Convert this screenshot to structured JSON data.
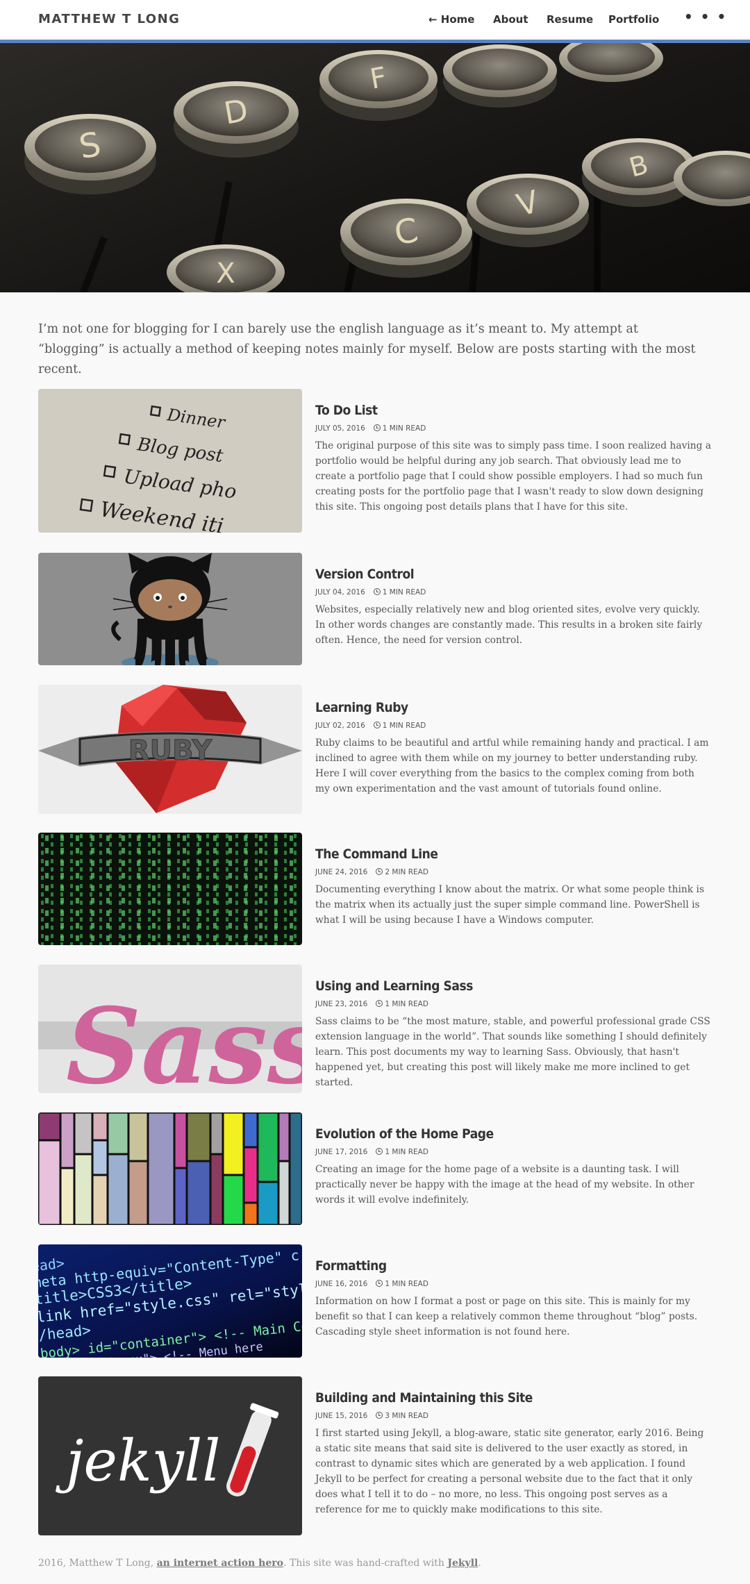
{
  "header": {
    "site_title": "MATTHEW T LONG",
    "nav": {
      "home": "← Home",
      "about": "About",
      "resume": "Resume",
      "portfolio": "Portfolio",
      "more": "• • •"
    },
    "accent_color": "#5a84c4"
  },
  "intro": "I’m not one for blogging for I can barely use the english language as it’s meant to. My attempt at “blogging” is actually a method of keeping notes mainly for myself. Below are posts starting with the most recent.",
  "posts": [
    {
      "title": "To Do List",
      "date": "JULY 05, 2016",
      "read_time": "1 MIN READ",
      "excerpt": "The original purpose of this site was to simply pass time. I soon realized having a portfolio would be helpful during any job search. That obviously lead me to create a portfolio page that I could show possible employers. I had so much fun creating posts for the portfolio page that I wasn't ready to slow down designing this site. This ongoing post details plans that I have for this site."
    },
    {
      "title": "Version Control",
      "date": "JULY 04, 2016",
      "read_time": "1 MIN READ",
      "excerpt": "Websites, especially relatively new and blog oriented sites, evolve very quickly. In other words changes are constantly made. This results in a broken site fairly often. Hence, the need for version control."
    },
    {
      "title": "Learning Ruby",
      "date": "JULY 02, 2016",
      "read_time": "1 MIN READ",
      "excerpt": "Ruby claims to be beautiful and artful while remaining handy and practical. I am inclined to agree with them while on my journey to better understanding ruby. Here I will cover everything from the basics to the complex coming from both my own experimentation and the vast amount of tutorials found online."
    },
    {
      "title": "The Command Line",
      "date": "JUNE 24, 2016",
      "read_time": "2 MIN READ",
      "excerpt": "Documenting everything I know about the matrix. Or what some people think is the matrix when its actually just the super simple command line. PowerShell is what I will be using because I have a Windows computer."
    },
    {
      "title": "Using and Learning Sass",
      "date": "JUNE 23, 2016",
      "read_time": "1 MIN READ",
      "excerpt": "Sass claims to be “the most mature, stable, and powerful professional grade CSS extension language in the world”. That sounds like something I should definitely learn. This post documents my way to learning Sass. Obviously, that hasn't happened yet, but creating this post will likely make me more inclined to get started."
    },
    {
      "title": "Evolution of the Home Page",
      "date": "JUNE 17, 2016",
      "read_time": "1 MIN READ",
      "excerpt": "Creating an image for the home page of a website is a daunting task. I will practically never be happy with the image at the head of my website. In other words it will evolve indefinitely."
    },
    {
      "title": "Formatting",
      "date": "JUNE 16, 2016",
      "read_time": "1 MIN READ",
      "excerpt": "Information on how I format a post or page on this site. This is mainly for my benefit so that I can keep a relatively common theme throughout “blog” posts. Cascading style sheet information is not found here."
    },
    {
      "title": "Building and Maintaining this Site",
      "date": "JUNE 15, 2016",
      "read_time": "3 MIN READ",
      "excerpt": "I first started using Jekyll, a blog-aware, static site generator, early 2016. Being a static site means that said site is delivered to the user exactly as stored, in contrast to dynamic sites which are generated by a web application. I found Jekyll to be perfect for creating a personal website due to the fact that it only does what I tell it to do – no more, no less. This ongoing post serves as a reference for me to quickly make modifications to this site."
    }
  ],
  "thumb_text": {
    "todo": [
      "Dinner",
      "Blog post",
      "Upload pho",
      "Weekend iti"
    ],
    "ruby": "RUBY",
    "sass": "Sass",
    "code": [
      "ead>",
      "meta http-equiv=\"Content-Type\" c",
      "title>CSS3</title>",
      "link href=\"style.css\" rel=\"style",
      "/head>",
      "body>  id=\"container\"> <!-- Main Con",
      "ss=\"menu\"> <!-- Menu here"
    ],
    "jekyll": "jekyll"
  },
  "hero_keys": [
    "S",
    "D",
    "F",
    "X",
    "C",
    "V",
    "B"
  ],
  "footer": {
    "prefix": "2016, Matthew T Long, ",
    "link1": "an internet action hero",
    "middle": ". This site was hand-crafted with ",
    "link2": "Jekyll",
    "suffix": "."
  }
}
